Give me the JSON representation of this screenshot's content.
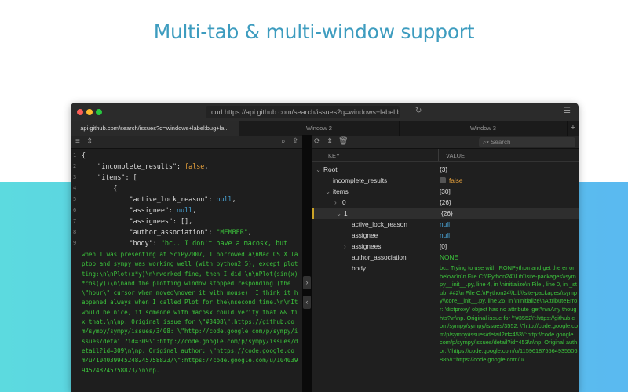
{
  "headline": "Multi-tab & multi-window support",
  "window": {
    "url": "curl https://api.github.com/search/issues?q=windows+label:bu",
    "tabs": [
      "api.github.com/search/issues?q=windows+label:bug+la...",
      "Window 2",
      "Window 3"
    ],
    "new_tab": "+",
    "search_placeholder": "Search"
  },
  "editor": {
    "lines": [
      {
        "n": "1",
        "html": "{"
      },
      {
        "n": "2",
        "key": "    \"incomplete_results\": ",
        "val": "false",
        "cls": "o",
        "end": ","
      },
      {
        "n": "3",
        "key": "    \"items\": [",
        "val": "",
        "cls": "",
        "end": ""
      },
      {
        "n": "4",
        "key": "        {",
        "val": "",
        "cls": "",
        "end": ""
      },
      {
        "n": "5",
        "key": "            \"active_lock_reason\": ",
        "val": "null",
        "cls": "b",
        "end": ","
      },
      {
        "n": "6",
        "key": "            \"assignee\": ",
        "val": "null",
        "cls": "b",
        "end": ","
      },
      {
        "n": "7",
        "key": "            \"assignees\": [],",
        "val": "",
        "cls": "",
        "end": ""
      },
      {
        "n": "8",
        "key": "            \"author_association\": ",
        "val": "\"MEMBER\"",
        "cls": "g",
        "end": ","
      },
      {
        "n": "9",
        "key": "            \"body\": ",
        "val": "\"bc.. I don't have a macosx, but",
        "cls": "g",
        "end": ""
      }
    ],
    "body_continuation": "when I was presenting at SciPy2007, I borrowed a\\nMac OS X laptop and sympy was working well (with python2.5), except plotting:\\n\\nPlot(x*y)\\n\\nworked fine, then I did:\\n\\nPlot(sin(x)*cos(y))\\n\\nand the plotting window stopped responding (the \\\"hour\\\" cursor when moved\\nover it with mouse). I think it happened always when I called Plot for the\\nsecond time.\\n\\nIt would be nice, if someone with macosx could verify that && fix that.\\n\\np. Original issue for \\\"#3408\\\":https://github.com/sympy/sympy/issues/3408: \\\"http://code.google.com/p/sympy/issues/detail?id=309\\\":http://code.google.com/p/sympy/issues/detail?id=309\\n\\np. Original author: \\\"https://code.google.com/u/104039945248245758823/\\\":https://code.google.com/u/104039945248245758823/\\n\\np."
  },
  "tree": {
    "col_key": "KEY",
    "col_value": "VALUE",
    "rows": [
      {
        "key": "Root",
        "value": "{3}",
        "indent": 0,
        "arrow": "⌄",
        "cls": "k"
      },
      {
        "key": "incomplete_results",
        "value": "false",
        "indent": 1,
        "arrow": "",
        "cls": "o",
        "checkbox": true
      },
      {
        "key": "items",
        "value": "[30]",
        "indent": 1,
        "arrow": "⌄",
        "cls": "k"
      },
      {
        "key": "0",
        "value": "{26}",
        "indent": 2,
        "arrow": "›",
        "cls": "k"
      },
      {
        "key": "1",
        "value": "{26}",
        "indent": 2,
        "arrow": "⌄",
        "cls": "k",
        "selected": true
      },
      {
        "key": "active_lock_reason",
        "value": "null",
        "indent": 3,
        "arrow": "",
        "cls": "b"
      },
      {
        "key": "assignee",
        "value": "null",
        "indent": 3,
        "arrow": "",
        "cls": "b"
      },
      {
        "key": "assignees",
        "value": "[0]",
        "indent": 3,
        "arrow": "›",
        "cls": "k"
      },
      {
        "key": "author_association",
        "value": "NONE",
        "indent": 3,
        "arrow": "",
        "cls": "g"
      },
      {
        "key": "body",
        "value": "",
        "indent": 3,
        "arrow": "",
        "cls": "k"
      }
    ],
    "body_value": "bc.. Trying to use with IRONPython and get the error below:\\n\\n  File C:\\\\Python24\\\\Lib\\\\site-packages\\\\sympy__init__.py, line 4, in \\ninitialize\\n  File , line 0, in _stub_##2\\n  File C:\\\\Python24\\\\Lib\\\\site-packages\\\\sympy\\\\core__init__.py, line 26, in \\ninitialize\\nAttributeError: 'dictproxy' object has no attribute 'get'\\n\\nAny thoughts?\\n\\np. Original issue for \\\"#3552\\\":https://github.com/sympy/sympy/issues/3552: \\\"http://code.google.com/p/sympy/issues/detail?id=453\\\":http://code.google.com/p/sympy/issues/detail?id=453\\n\\np. Original author: \\\"https://code.google.com/u/115961875564935506885/\\\":https://code.google.com/u/"
  },
  "colors": {
    "accent": "#3d9cbf",
    "string": "#3cc43c",
    "null": "#4aa6d8",
    "bool": "#e8a23c"
  }
}
